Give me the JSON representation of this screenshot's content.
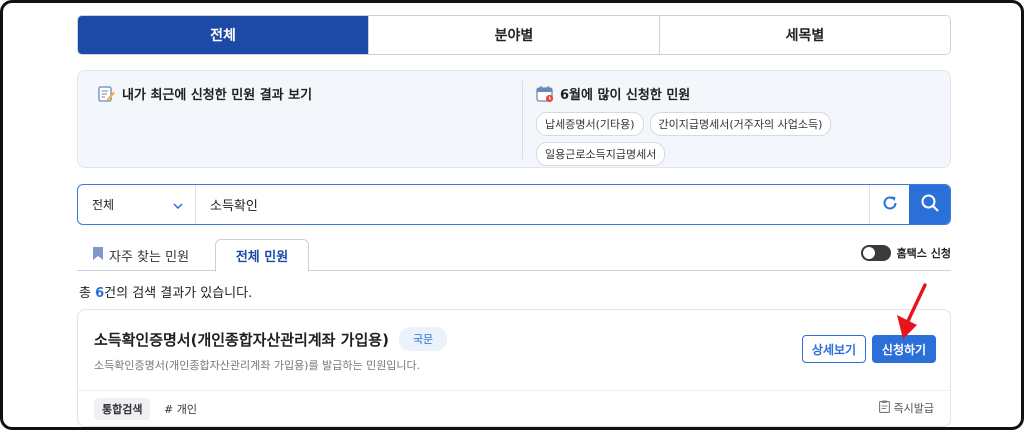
{
  "top_tabs": [
    {
      "label": "전체",
      "active": true
    },
    {
      "label": "분야별",
      "active": false
    },
    {
      "label": "세목별",
      "active": false
    }
  ],
  "info": {
    "recent_title": "내가 최근에 신청한 민원 결과 보기",
    "popular_title": "6월에 많이 신청한 민원",
    "popular_items": [
      "납세증명서(기타용)",
      "간이지급명세서(거주자의 사업소득)",
      "일용근로소득지급명세서"
    ]
  },
  "search": {
    "category": "전체",
    "query": "소득확인"
  },
  "sub_tabs": {
    "favorites": "자주 찾는 민원",
    "all": "전체 민원",
    "hometax_toggle": "홈택스 신청"
  },
  "results": {
    "prefix": "총 ",
    "count": "6",
    "suffix": "건의 검색 결과가 있습니다."
  },
  "card": {
    "title": "소득확인증명서(개인종합자산관리계좌 가입용)",
    "badge": "국문",
    "description": "소득확인증명서(개인종합자산관리계좌 가입용)를 발급하는 민원입니다.",
    "tag_unified": "통합검색",
    "tag_personal": "# 개인",
    "instant": "즉시발급",
    "detail_button": "상세보기",
    "apply_button": "신청하기"
  },
  "colors": {
    "primary": "#1c4aa6",
    "accent": "#2b6fd8",
    "annotation_arrow": "#e8141b"
  }
}
